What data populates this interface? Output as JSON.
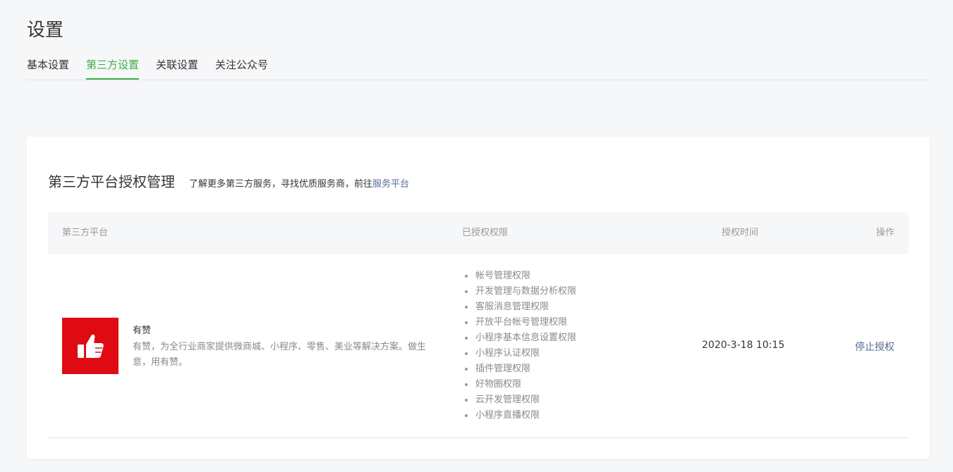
{
  "page": {
    "title": "设置"
  },
  "tabs": [
    {
      "label": "基本设置",
      "active": false
    },
    {
      "label": "第三方设置",
      "active": true
    },
    {
      "label": "关联设置",
      "active": false
    },
    {
      "label": "关注公众号",
      "active": false
    }
  ],
  "card": {
    "title": "第三方平台授权管理",
    "description": "了解更多第三方服务，寻找优质服务商，前往",
    "link_label": "服务平台"
  },
  "table": {
    "headers": {
      "platform": "第三方平台",
      "permissions": "已授权权限",
      "time": "授权时间",
      "action": "操作"
    },
    "rows": [
      {
        "logo_icon": "thumbs-up-icon",
        "logo_color": "#e00b12",
        "name": "有赞",
        "description": "有赞，为全行业商家提供微商城、小程序、零售、美业等解决方案。做生意，用有赞。",
        "permissions": [
          "帐号管理权限",
          "开发管理与数据分析权限",
          "客服消息管理权限",
          "开放平台帐号管理权限",
          "小程序基本信息设置权限",
          "小程序认证权限",
          "插件管理权限",
          "好物圈权限",
          "云开发管理权限",
          "小程序直播权限"
        ],
        "auth_time": "2020-3-18 10:15",
        "action_label": "停止授权"
      }
    ]
  },
  "colors": {
    "accent": "#3db04a",
    "link": "#576b95",
    "logo_bg": "#e00b12"
  }
}
